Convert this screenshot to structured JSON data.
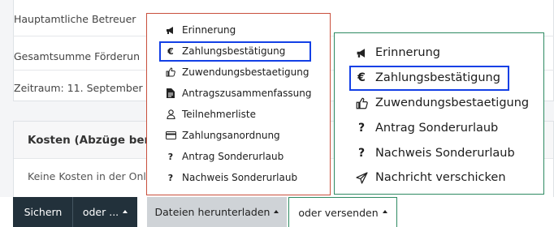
{
  "background": {
    "rows": [
      "Hauptamtliche Betreuer",
      "Gesamtsumme Förderun",
      "Zeitraum: 11. September"
    ],
    "cost_panel": {
      "title": "Kosten (Abzüge ber",
      "text": "Keine Kosten in der Onli"
    }
  },
  "bottom_bar": {
    "save_label": "Sichern",
    "or_label": "oder ...",
    "download_label": "Dateien herunterladen",
    "send_label": "oder versenden"
  },
  "download_menu": {
    "items": [
      {
        "label": "Erinnerung",
        "icon": "bullhorn-icon"
      },
      {
        "label": "Zahlungsbestätigung",
        "icon": "euro-icon",
        "highlighted": true
      },
      {
        "label": "Zuwendungsbestaetigung",
        "icon": "thumbs-up-icon"
      },
      {
        "label": "Antragszusammenfassung",
        "icon": "document-icon"
      },
      {
        "label": "Teilnehmerliste",
        "icon": "user-icon"
      },
      {
        "label": "Zahlungsanordnung",
        "icon": "credit-card-icon"
      },
      {
        "label": "Antrag Sonderurlaub",
        "icon": "question-icon"
      },
      {
        "label": "Nachweis Sonderurlaub",
        "icon": "question-icon"
      }
    ]
  },
  "send_menu": {
    "items": [
      {
        "label": "Erinnerung",
        "icon": "bullhorn-icon"
      },
      {
        "label": "Zahlungsbestätigung",
        "icon": "euro-icon",
        "highlighted": true
      },
      {
        "label": "Zuwendungsbestaetigung",
        "icon": "thumbs-up-icon"
      },
      {
        "label": "Antrag Sonderurlaub",
        "icon": "question-icon"
      },
      {
        "label": "Nachweis Sonderurlaub",
        "icon": "question-icon"
      },
      {
        "label": "Nachricht verschicken",
        "icon": "paper-plane-icon"
      }
    ]
  },
  "colors": {
    "download_menu_border": "#c9503d",
    "send_menu_border": "#2e8a62",
    "highlight": "#1340e6",
    "dark_button": "#22313b"
  }
}
